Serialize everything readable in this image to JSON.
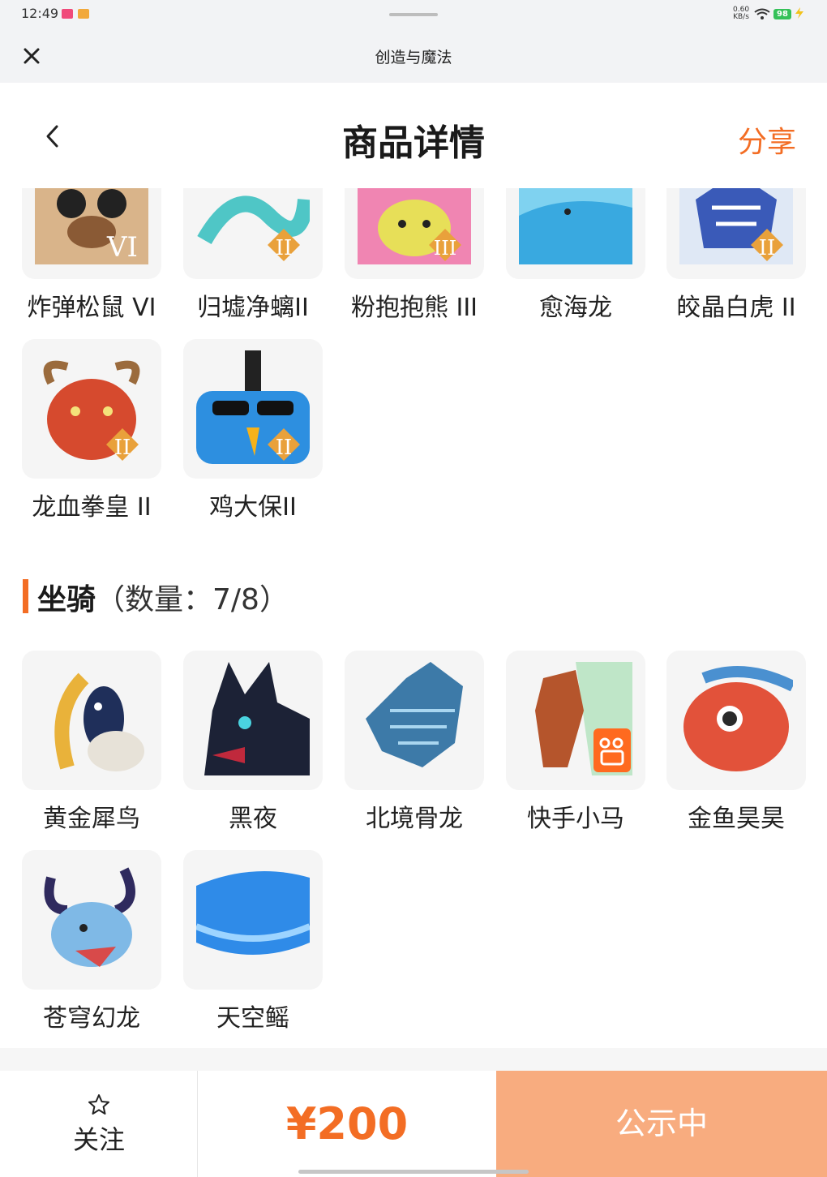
{
  "status_bar": {
    "time": "12:49",
    "network_speed": "0.60",
    "network_unit": "KB/s",
    "battery": "98",
    "battery_color": "#35c159"
  },
  "mini_header": {
    "title": "创造与魔法",
    "close_icon": "close-icon"
  },
  "nav": {
    "title": "商品详情",
    "share_label": "分享",
    "back_icon": "chevron-left-icon"
  },
  "pets": {
    "items": [
      {
        "name": "炸弹松鼠 VI",
        "badge": "VI",
        "art": "squirrel"
      },
      {
        "name": "归墟净螭II",
        "badge": "II",
        "art": "serpent"
      },
      {
        "name": "粉抱抱熊 III",
        "badge": "III",
        "art": "bear"
      },
      {
        "name": "愈海龙",
        "badge": "",
        "art": "sea-dragon"
      },
      {
        "name": "皎晶白虎 II",
        "badge": "II",
        "art": "tiger"
      },
      {
        "name": "龙血拳皇 II",
        "badge": "II",
        "art": "ox"
      },
      {
        "name": "鸡大保II",
        "badge": "II",
        "art": "chick"
      }
    ]
  },
  "mounts": {
    "section_title": "坐骑",
    "section_count": "（数量：7/8）",
    "items": [
      {
        "name": "黄金犀鸟",
        "badge": "",
        "art": "hornbill"
      },
      {
        "name": "黑夜",
        "badge": "",
        "art": "night"
      },
      {
        "name": "北境骨龙",
        "badge": "",
        "art": "bone-dragon"
      },
      {
        "name": "快手小马",
        "badge": "kuaishou",
        "art": "horse"
      },
      {
        "name": "金鱼昊昊",
        "badge": "",
        "art": "goldfish"
      },
      {
        "name": "苍穹幻龙",
        "badge": "",
        "art": "sky-dragon"
      },
      {
        "name": "天空鳐",
        "badge": "",
        "art": "sky-ray"
      }
    ]
  },
  "bottom_bar": {
    "follow_label": "关注",
    "follow_icon": "star-icon",
    "price": "¥200",
    "status_label": "公示中",
    "accent_color": "#f36d24",
    "status_bg": "#f8ac7f"
  }
}
